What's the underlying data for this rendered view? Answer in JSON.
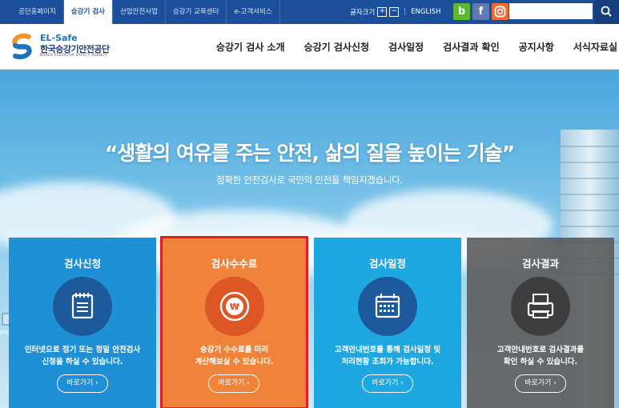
{
  "topbar": {
    "tabs": [
      {
        "label": "공단홈페이지",
        "active": false
      },
      {
        "label": "승강기 검사",
        "active": true
      },
      {
        "label": "산업안전사업",
        "active": false
      },
      {
        "label": "승강기 교육센터",
        "active": false
      },
      {
        "label": "e-고객서비스",
        "active": false
      }
    ],
    "font_size_label": "글자크기",
    "font_plus": "+",
    "font_minus": "−",
    "english_label": "ENGLISH",
    "sns": [
      {
        "icon": "blog-icon",
        "glyph": "b",
        "color": "#5cb82e"
      },
      {
        "icon": "facebook-icon",
        "glyph": "f",
        "color": "#5f79b5"
      },
      {
        "icon": "instagram-icon",
        "glyph": "◎",
        "color": "#f06a35"
      }
    ],
    "search_placeholder": ""
  },
  "header": {
    "logo_en": "EL-Safe",
    "logo_kr": "한국승강기안전공단",
    "logo_sub": "KOREA ELEVATOR SAFETY AGENCY",
    "nav": [
      "승강기 검사 소개",
      "승강기 검사신청",
      "검사일정",
      "검사결과 확인",
      "공지사항",
      "서식자료실"
    ]
  },
  "hero": {
    "headline": "“생활의 여유를 주는 안전, 삶의 질을 높이는 기술”",
    "subline": "정확한 안전검사로 국민의 안전을 책임지겠습니다."
  },
  "cards": [
    {
      "title": "검사신청",
      "icon": "notepad-icon",
      "desc1": "인터넷으로 정기 또는 정밀 안전검사",
      "desc2": "신청을 하실 수 있습니다.",
      "button": "바로가기 ›",
      "color": "#1f8fd6"
    },
    {
      "title": "검사수수료",
      "icon": "won-coin-icon",
      "desc1": "승강기 수수료를 미리",
      "desc2": "계산해보실 수 있습니다.",
      "button": "바로가기 ›",
      "color": "#f0833a"
    },
    {
      "title": "검사일정",
      "icon": "calendar-icon",
      "desc1": "고객안내번호를 통해 검사일정 및",
      "desc2": "처리현황 조회가 가능합니다.",
      "button": "바로가기 ›",
      "color": "#1ea7e0"
    },
    {
      "title": "검사결과",
      "icon": "printer-icon",
      "desc1": "고객안내번호로 검사결과를",
      "desc2": "확인 하실 수 있습니다.",
      "button": "바로가기 ›",
      "color": "#5a5a5a"
    }
  ],
  "edge_label": "png"
}
